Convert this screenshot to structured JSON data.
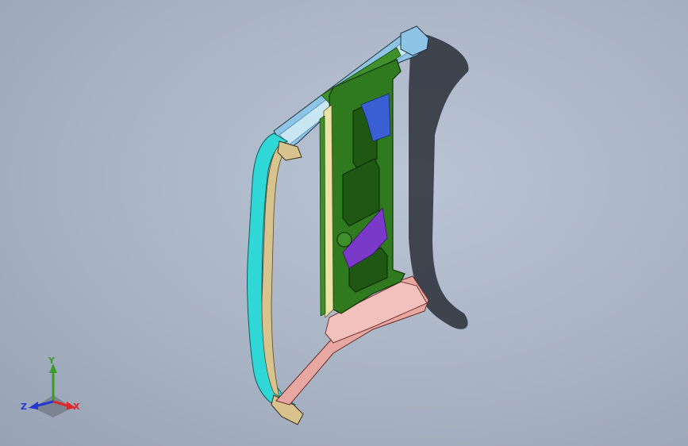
{
  "viewport": {
    "background_color": "#a8b3c4"
  },
  "model": {
    "colors": {
      "green_panel": "#2f7a1f",
      "green_dark": "#1f5812",
      "pink_floor": "#e8a7a1",
      "cyan_edge": "#2fd8d6",
      "tan": "#d8c38f",
      "purple": "#7a39c9",
      "blue": "#3a5fd3",
      "light_blue": "#8ec4e6",
      "shadow": "#2a2f38"
    }
  },
  "triad": {
    "x_label": "X",
    "y_label": "Y",
    "z_label": "Z",
    "x_color": "#e0262b",
    "y_color": "#3a9d2b",
    "z_color": "#2438d4"
  }
}
